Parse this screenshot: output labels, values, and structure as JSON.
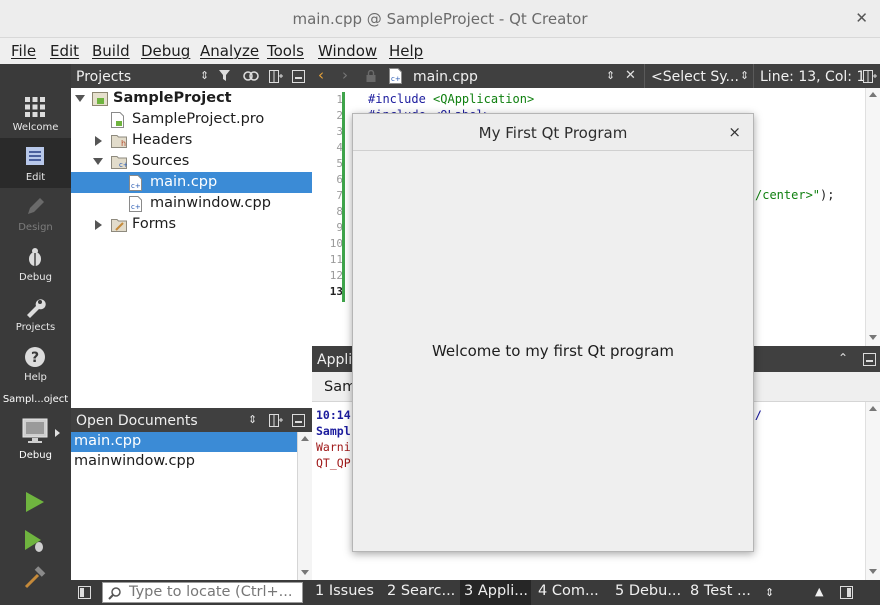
{
  "window": {
    "title": "main.cpp @ SampleProject - Qt Creator"
  },
  "menu": [
    "File",
    "Edit",
    "Build",
    "Debug",
    "Analyze",
    "Tools",
    "Window",
    "Help"
  ],
  "modes": [
    {
      "label": "Welcome",
      "icon": "grid-icon"
    },
    {
      "label": "Edit",
      "icon": "edit-icon"
    },
    {
      "label": "Design",
      "icon": "pencil-icon"
    },
    {
      "label": "Debug",
      "icon": "bug-icon"
    },
    {
      "label": "Projects",
      "icon": "wrench-icon"
    },
    {
      "label": "Help",
      "icon": "help-icon"
    }
  ],
  "kit": {
    "project": "Sampl...oject",
    "config": "Debug"
  },
  "projects_pane": {
    "title": "Projects",
    "tree": [
      {
        "label": "SampleProject"
      },
      {
        "label": "SampleProject.pro"
      },
      {
        "label": "Headers"
      },
      {
        "label": "Sources"
      },
      {
        "label": "main.cpp"
      },
      {
        "label": "mainwindow.cpp"
      },
      {
        "label": "Forms"
      }
    ]
  },
  "open_documents": {
    "title": "Open Documents",
    "docs": [
      "main.cpp",
      "mainwindow.cpp"
    ]
  },
  "editor": {
    "file_tab": "main.cpp",
    "symbol_select": "<Select Sy...",
    "cursor_position": "Line: 13, Col: 1",
    "line_numbers": [
      "1",
      "2",
      "3",
      "4",
      "5",
      "6",
      "7",
      "8",
      "9",
      "10",
      "11",
      "12",
      "13"
    ],
    "line1_directive": "#include ",
    "line1_header": "<QApplication>",
    "line2_fragment": "#include <QLabel>",
    "line7_tail_string": "/center>\"",
    "line7_tail_end": ");"
  },
  "output_pane": {
    "title": "Appli",
    "tab_label": "Sam",
    "path_tail": "bug/",
    "lines": [
      "10:14",
      "Sampl",
      "Warni",
      "QT_QP"
    ]
  },
  "bottom_bar": {
    "locator_placeholder": "Type to locate (Ctrl+...",
    "tabs": [
      "1  Issues",
      "2  Searc...",
      "3  Appli...",
      "4  Com...",
      "5  Debu...",
      "8  Test ..."
    ]
  },
  "dialog": {
    "title": "My First Qt Program",
    "label": "Welcome to my first Qt program",
    "close": "×"
  },
  "colors": {
    "selection": "#3b8bd6",
    "modebar": "#3a3a3a",
    "run_green": "#6fb43f"
  }
}
